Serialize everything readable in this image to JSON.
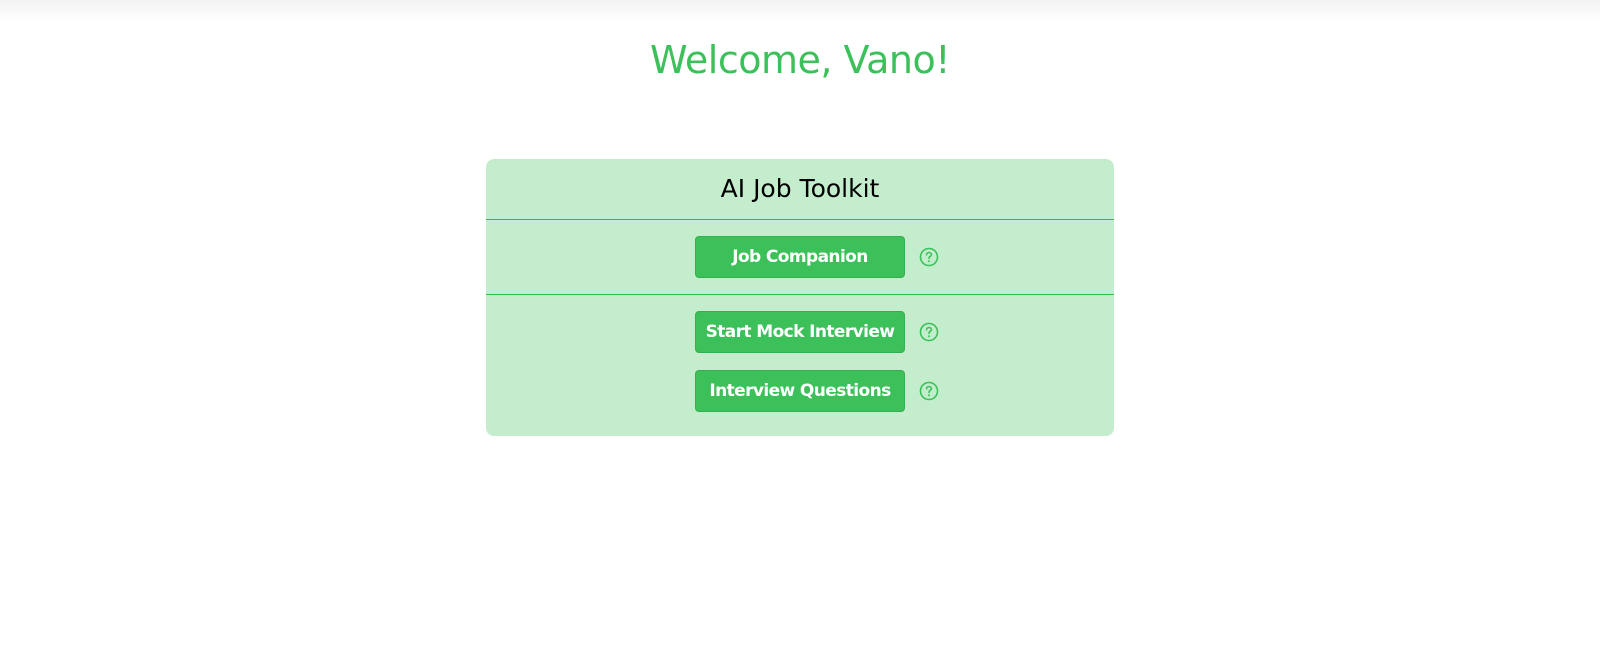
{
  "header": {
    "welcome": "Welcome, Vano!"
  },
  "toolkit": {
    "title": "AI Job Toolkit",
    "buttons": [
      {
        "label": "Job Companion",
        "help_icon": "question-circle-icon"
      },
      {
        "label": "Start Mock Interview",
        "help_icon": "question-circle-icon"
      },
      {
        "label": "Interview Questions",
        "help_icon": "question-circle-icon"
      }
    ]
  },
  "colors": {
    "accent": "#3cc15a",
    "panel_background": "#c4edcd",
    "divider": "#2fbd4f"
  }
}
